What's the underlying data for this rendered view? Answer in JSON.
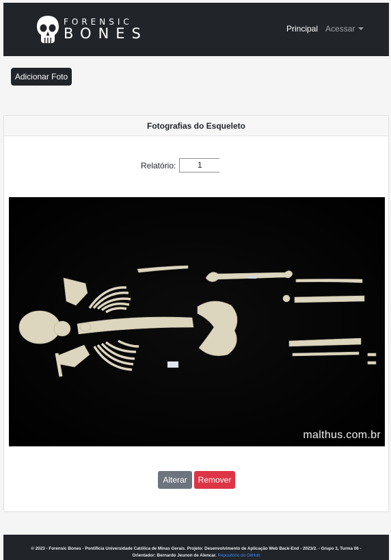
{
  "brand": {
    "logo_top": "FORENSIC",
    "logo_bottom": "BONES",
    "logo_icon": "skull-icon"
  },
  "nav": {
    "principal": "Principal",
    "acessar": "Acessar"
  },
  "actions": {
    "add_photo": "Adicionar Foto"
  },
  "card": {
    "title": "Fotografias do Esqueleto",
    "relatorio_label": "Relatório:",
    "relatorio_value": "1",
    "photo_watermark": "malthus.com.br",
    "photo_subject": "skeleton-photo",
    "alterar": "Alterar",
    "remover": "Remover"
  },
  "footer": {
    "text": "© 2023 - Forensic Bones - Pontifícia Universidade Católica de Minas Gerais. Projeto: Desenvolvimento de Aplicação Web Back-End - 2023/2. - Grupo 3, Turma 06 - Orientador: Bernardo Jeunon de Alencar.",
    "link": "Repositório do GitHub"
  },
  "colors": {
    "navbar": "#212529",
    "secondary": "#6c757d",
    "danger": "#dc3545",
    "link": "#3d8bfd"
  }
}
